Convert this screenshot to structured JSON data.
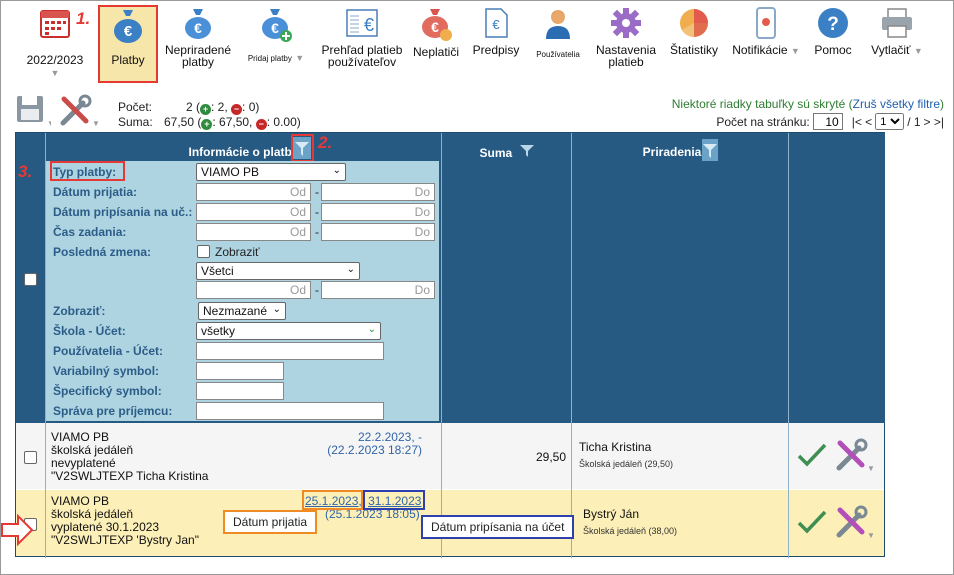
{
  "toolbar": {
    "year": "2022/2023",
    "items": [
      {
        "id": "platby",
        "label": "Platby"
      },
      {
        "id": "nepriradene",
        "label1": "Nepriradené",
        "label2": "platby"
      },
      {
        "id": "pridaj",
        "label": "Pridaj platby"
      },
      {
        "id": "prehlad",
        "label1": "Prehľad platieb",
        "label2": "používateľov"
      },
      {
        "id": "neplatici",
        "label": "Neplatiči"
      },
      {
        "id": "predpisy",
        "label": "Predpisy"
      },
      {
        "id": "pouzivatelia",
        "label": "Používatelia"
      },
      {
        "id": "nastavenia",
        "label1": "Nastavenia",
        "label2": "platieb"
      },
      {
        "id": "statistiky",
        "label": "Štatistiky"
      },
      {
        "id": "notifikacie",
        "label": "Notifikácie"
      },
      {
        "id": "pomoc",
        "label": "Pomoc"
      },
      {
        "id": "vytlacit",
        "label": "Vytlačiť"
      }
    ]
  },
  "marks": {
    "m1": "1.",
    "m2": "2.",
    "m3": "3."
  },
  "status": {
    "count_label": "Počet:",
    "count_value": "2 (",
    "count_green": "+",
    "count_green_val": ": 2,",
    "count_red": "−",
    "count_red_val": ": 0)",
    "sum_label": "Suma:",
    "sum_value": "67,50 (",
    "sum_green_val": ": 67,50,",
    "sum_red_val": ": 0.00)",
    "hidden_note": "Niektoré riadky tabuľky sú skryté (",
    "hidden_link": "Zruš všetky filtre",
    "hidden_close": ")",
    "perpage_label": "Počet na stránku:",
    "perpage_value": "10",
    "pager_prev": "|< <",
    "pager_page": "1",
    "pager_total": "/ 1",
    "pager_next": "> >|"
  },
  "table": {
    "col_info": "Informácie o platbe",
    "col_suma": "Suma",
    "col_priradenia": "Priradenia"
  },
  "filters": {
    "typ_platby": "Typ platby:",
    "typ_platby_value": "VIAMO PB",
    "datum_prijatia": "Dátum prijatia:",
    "datum_pripisania": "Dátum pripísania na uč.:",
    "cas_zadania": "Čas zadania:",
    "posledna_zmena": "Posledná zmena:",
    "zobrazit_check": "Zobraziť",
    "vsetci": "Všetci",
    "zobrazit": "Zobraziť:",
    "zobrazit_value": "Nezmazané",
    "skola_ucet": "Škola - Účet:",
    "skola_ucet_value": "všetky",
    "pouzivatelia_ucet": "Používatelia - Účet:",
    "variabilny": "Variabilný symbol:",
    "specificky": "Špecifický symbol:",
    "sprava": "Správa pre príjemcu:",
    "od": "Od",
    "do": "Do",
    "dash": "-"
  },
  "rows": [
    {
      "l1": "VIAMO PB",
      "l2": "školská jedáleň",
      "l3": "nevyplatené",
      "l4": "\"V2SWLJTEXP Ticha Kristina",
      "d1": "22.2.2023, -",
      "d2": "(22.2.2023 18:27)",
      "sum": "29,50",
      "name": "Ticha Kristina",
      "sub": "Školská jedáleň (29,50)"
    },
    {
      "l1": "VIAMO PB",
      "l2": "školská jedáleň",
      "l3": "vyplatené 30.1.2023",
      "l4": "\"V2SWLJTEXP 'Bystry Jan\"",
      "d1a": "25.1.2023,",
      "d1b": "31.1.2023",
      "d2": "(25.1.2023 18:05)",
      "sum": "",
      "name": "Bystrý Ján",
      "sub": "Školská jedáleň (38,00)"
    }
  ],
  "callouts": {
    "prijatia": "Dátum prijatia",
    "pripisania": "Dátum pripísania na účet"
  }
}
